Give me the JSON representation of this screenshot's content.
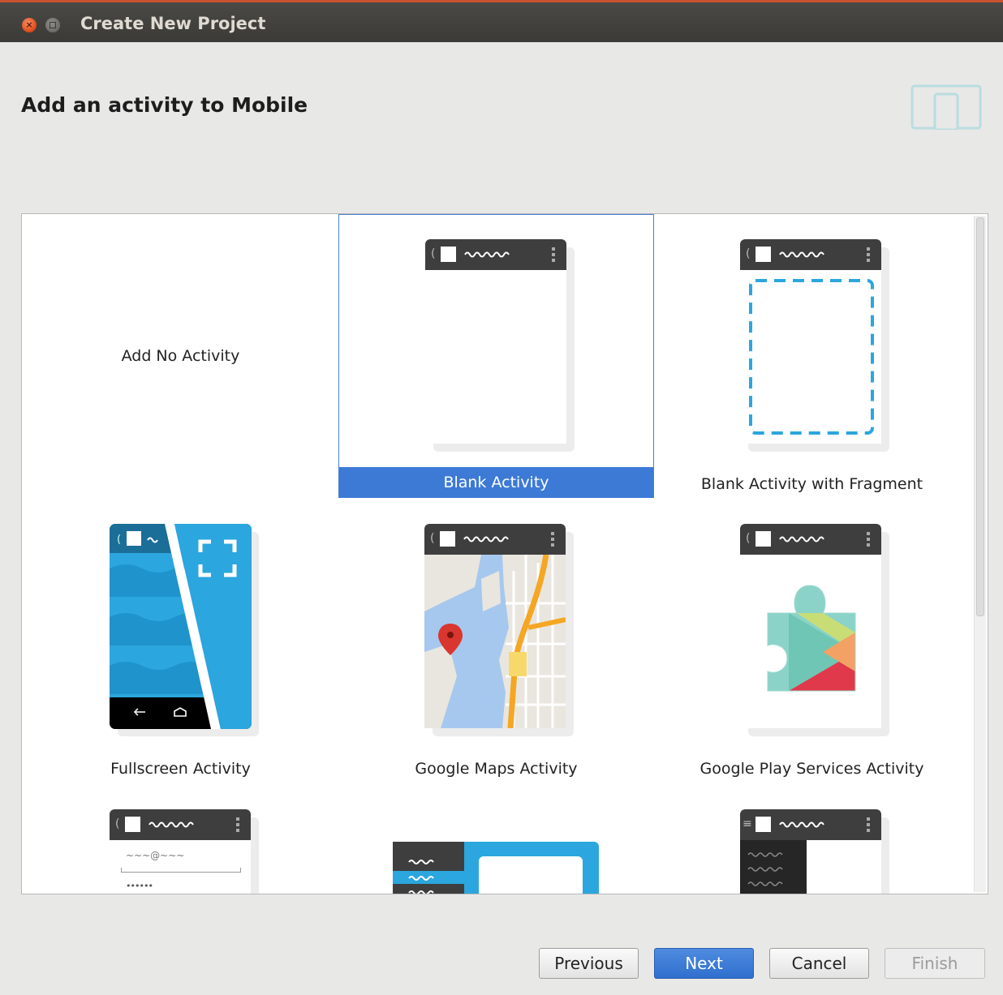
{
  "window": {
    "title": "Create New Project"
  },
  "heading": "Add an activity to Mobile",
  "templates": [
    {
      "label": "Add No Activity"
    },
    {
      "label": "Blank Activity"
    },
    {
      "label": "Blank Activity with Fragment"
    },
    {
      "label": "Fullscreen Activity"
    },
    {
      "label": "Google Maps Activity"
    },
    {
      "label": "Google Play Services Activity"
    }
  ],
  "selected_template": "Blank Activity",
  "login_preview": {
    "email": "~~~@~~~",
    "password": "••••••"
  },
  "buttons": {
    "previous": "Previous",
    "next": "Next",
    "cancel": "Cancel",
    "finish": "Finish"
  },
  "colors": {
    "selection": "#3d7ad6",
    "accent": "#2ba6de"
  }
}
